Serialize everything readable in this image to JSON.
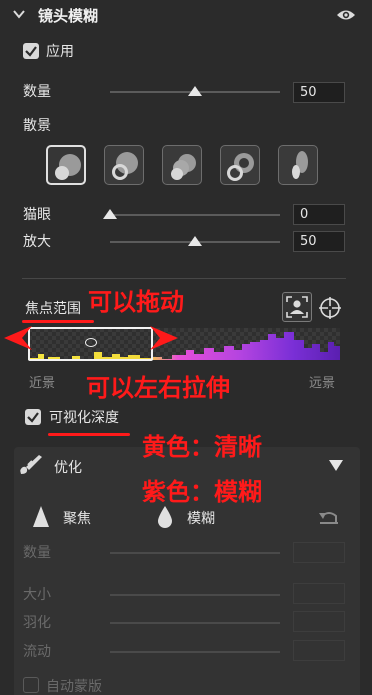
{
  "header": {
    "title": "镜头模糊"
  },
  "apply": {
    "label": "应用",
    "checked": true
  },
  "amount": {
    "label": "数量",
    "value": "50",
    "level": 0.5
  },
  "bokeh": {
    "label": "散景",
    "selected_index": 0
  },
  "cat_eye": {
    "label": "猫眼",
    "value": "0",
    "level": 0.0
  },
  "magnify": {
    "label": "放大",
    "value": "50",
    "level": 0.5
  },
  "focus_range": {
    "label": "焦点范围",
    "near_label": "近景",
    "far_label": "远景"
  },
  "visualize_depth": {
    "label": "可视化深度",
    "checked": true
  },
  "optimize": {
    "label": "优化",
    "focus_label": "聚焦",
    "blur_label": "模糊",
    "amount_label": "数量",
    "size_label": "大小",
    "feather_label": "羽化",
    "flow_label": "流动",
    "auto_mask_label": "自动蒙版",
    "auto_mask_checked": false
  },
  "annotations": {
    "drag": "可以拖动",
    "stretch": "可以左右拉伸",
    "yellow": "黄色：清晰",
    "purple": "紫色：模糊"
  },
  "colors": {
    "annotation": "#ff1a1a",
    "near_histogram": "#f5e640",
    "far_histogram": "#7a2fd6",
    "mid_histogram": "#e84fd8"
  }
}
